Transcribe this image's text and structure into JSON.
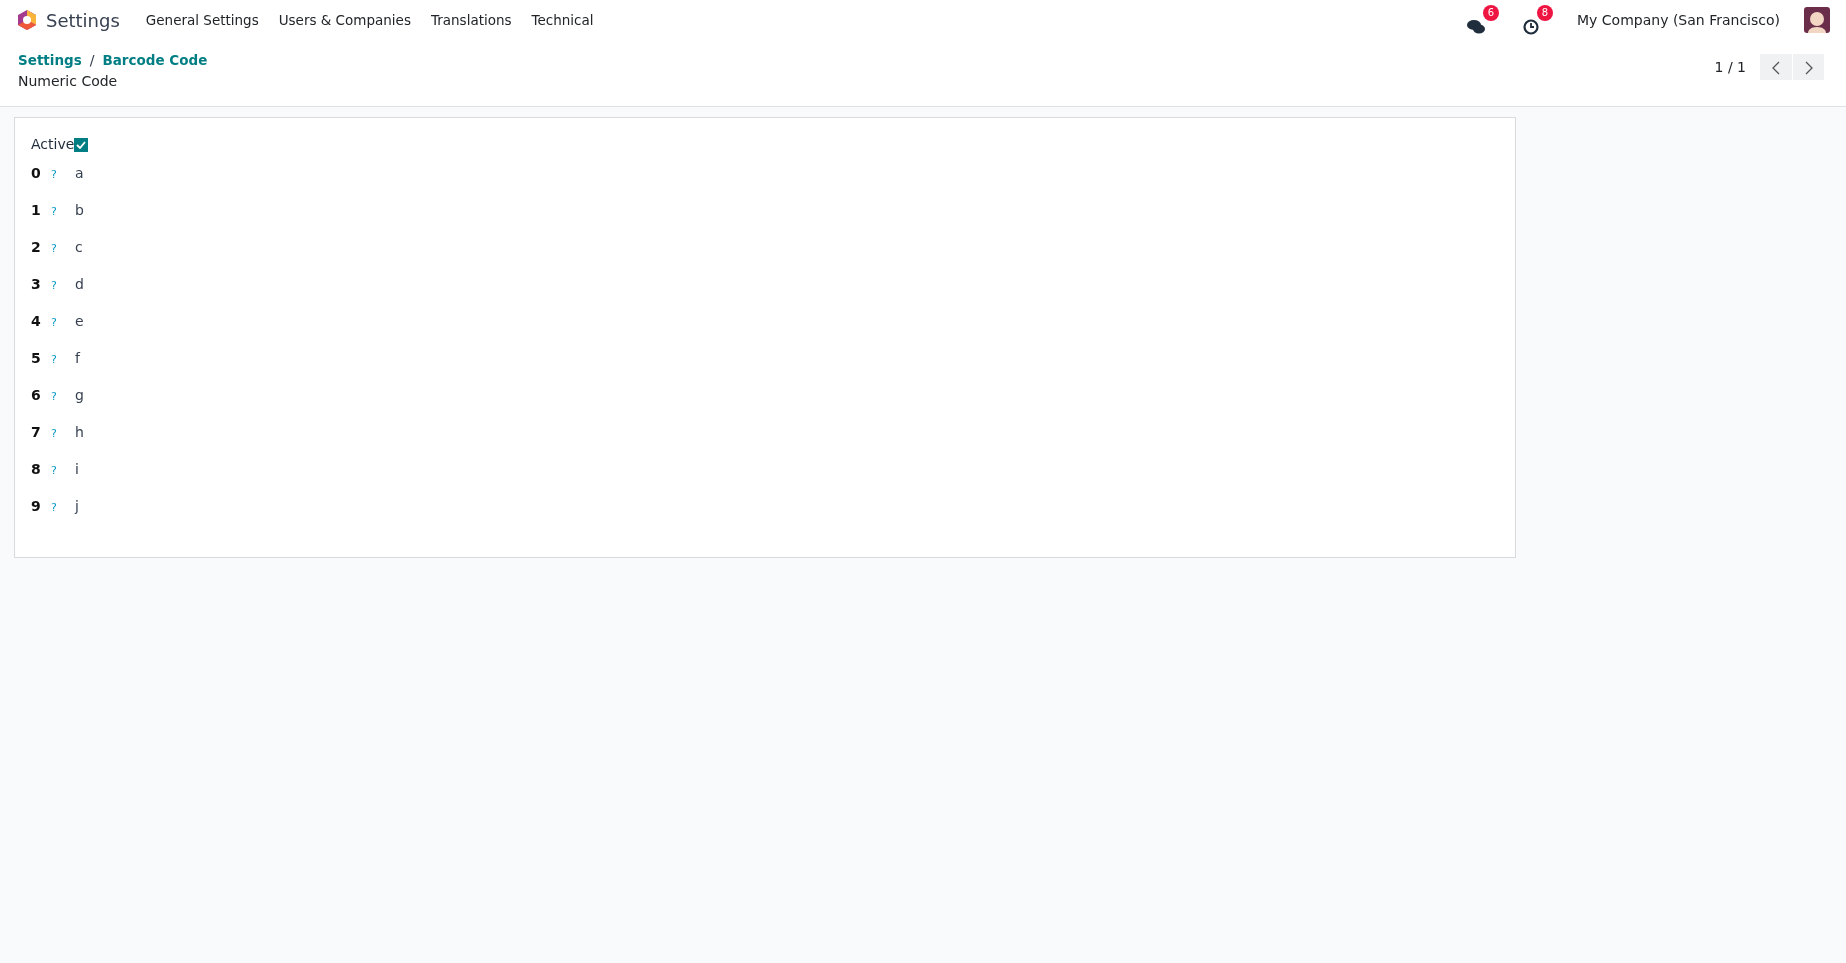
{
  "navbar": {
    "app_name": "Settings",
    "menu": [
      "General Settings",
      "Users & Companies",
      "Translations",
      "Technical"
    ],
    "messages_count": "6",
    "activities_count": "8",
    "company": "My Company (San Francisco)"
  },
  "breadcrumb": [
    "Settings",
    "Barcode Code"
  ],
  "breadcrumb_separator": "/",
  "title": "Numeric Code",
  "pager": "1 / 1",
  "form": {
    "active_label": "Active",
    "active": true,
    "help_mark": "?",
    "rows": [
      {
        "label": "0",
        "value": "a"
      },
      {
        "label": "1",
        "value": "b"
      },
      {
        "label": "2",
        "value": "c"
      },
      {
        "label": "3",
        "value": "d"
      },
      {
        "label": "4",
        "value": "e"
      },
      {
        "label": "5",
        "value": "f"
      },
      {
        "label": "6",
        "value": "g"
      },
      {
        "label": "7",
        "value": "h"
      },
      {
        "label": "8",
        "value": "i"
      },
      {
        "label": "9",
        "value": "j"
      }
    ]
  }
}
